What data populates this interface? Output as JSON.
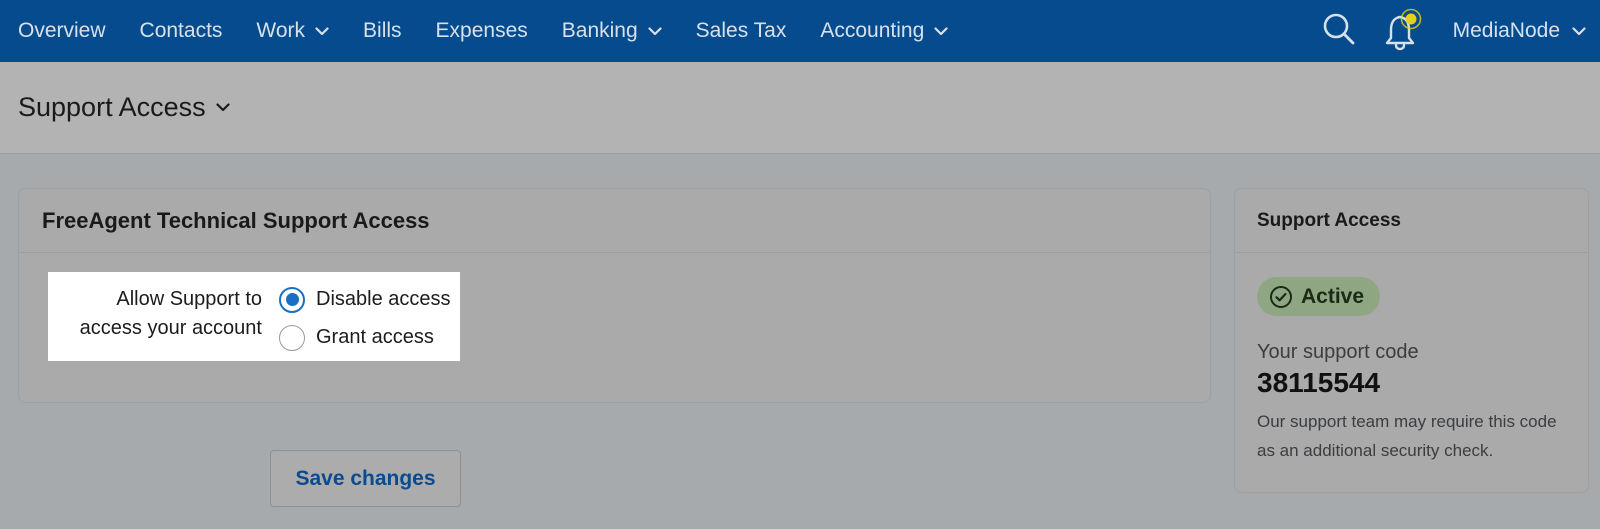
{
  "nav": {
    "items": [
      {
        "label": "Overview",
        "dropdown": false
      },
      {
        "label": "Contacts",
        "dropdown": false
      },
      {
        "label": "Work",
        "dropdown": true
      },
      {
        "label": "Bills",
        "dropdown": false
      },
      {
        "label": "Expenses",
        "dropdown": false
      },
      {
        "label": "Banking",
        "dropdown": true
      },
      {
        "label": "Sales Tax",
        "dropdown": false
      },
      {
        "label": "Accounting",
        "dropdown": true
      }
    ],
    "search_icon": "search-icon",
    "notification_icon": "bell-icon",
    "account_name": "MediaNode"
  },
  "page": {
    "title": "Support Access"
  },
  "main_card": {
    "title": "FreeAgent Technical Support Access",
    "option_label_line1": "Allow Support to",
    "option_label_line2": "access your account",
    "options": [
      {
        "label": "Disable access",
        "checked": true
      },
      {
        "label": "Grant access",
        "checked": false
      }
    ]
  },
  "save_button": {
    "label": "Save changes"
  },
  "side_card": {
    "title": "Support Access",
    "status": "Active",
    "code_label": "Your support code",
    "code_value": "38115544",
    "note": "Our support team may require this code as an additional security check."
  },
  "colors": {
    "nav_bg": "#064b8d",
    "accent": "#1a6fc4",
    "badge_bg": "#8fa683",
    "notification_dot": "#e6d21a"
  }
}
